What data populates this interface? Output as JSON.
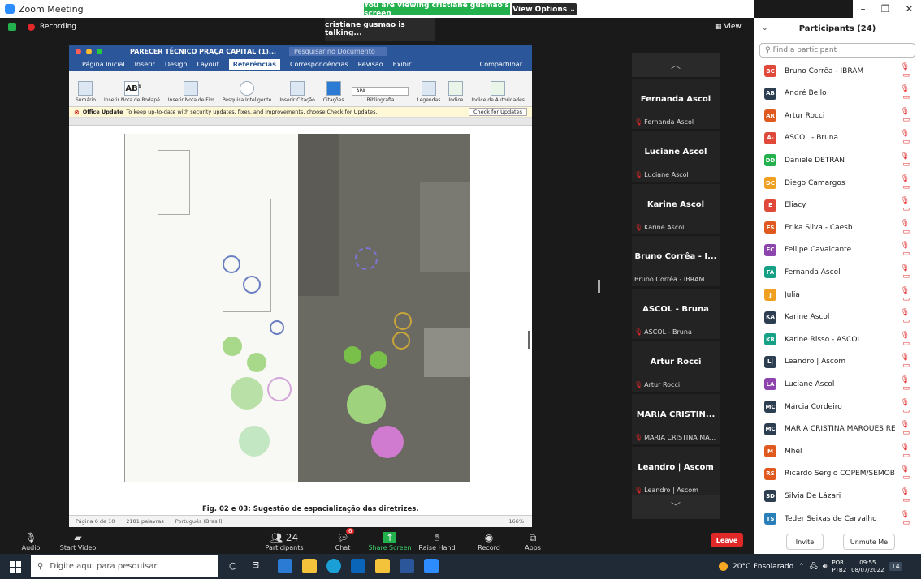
{
  "titlebar": {
    "app_title": "Zoom Meeting",
    "minimize": "–",
    "maximize": "❐",
    "close": "✕"
  },
  "banner": {
    "text": "You are viewing cristiane gusmao's screen",
    "view_options": "View Options ⌄"
  },
  "meeting": {
    "recording": "Recording",
    "talking": "cristiane gusmao is talking...",
    "view": "View"
  },
  "word": {
    "title": "PARECER TÉCNICO PRAÇA CAPITAL (1)...",
    "search_placeholder": "Pesquisar no Documento",
    "tabs": [
      "Página Inicial",
      "Inserir",
      "Design",
      "Layout",
      "Referências",
      "Correspondências",
      "Revisão",
      "Exibir"
    ],
    "active_tab": "Referências",
    "share": "Compartilhar",
    "ribbon": [
      "Sumário",
      "Inserir Nota de Rodapé",
      "Inserir Nota de Fim",
      "Pesquisa Inteligente",
      "Inserir Citação",
      "Citações",
      "Bibliografia",
      "Legendas",
      "Índice",
      "Índice de Autoridades"
    ],
    "citation_style": "APA",
    "update_label": "Office Update",
    "update_text": "To keep up-to-date with security updates, fixes, and improvements, choose Check for Updates.",
    "update_button": "Check for Updates",
    "caption": "Fig. 02 e 03: Sugestão de espacialização das diretrizes.",
    "status_page": "Página 6 de 10",
    "status_words": "2181 palavras",
    "status_lang": "Português (Brasil)",
    "zoom": "166%"
  },
  "strip": {
    "up": "︿",
    "down": "﹀",
    "tiles": [
      {
        "name": "Fernanda Ascol",
        "sub": "Fernanda Ascol",
        "muted": true
      },
      {
        "name": "Luciane Ascol",
        "sub": "Luciane Ascol",
        "muted": true
      },
      {
        "name": "Karine Ascol",
        "sub": "Karine Ascol",
        "muted": true
      },
      {
        "name": "Bruno Corrêa - I...",
        "sub": "Bruno Corrêa - IBRAM",
        "muted": false
      },
      {
        "name": "ASCOL - Bruna",
        "sub": "ASCOL - Bruna",
        "muted": true
      },
      {
        "name": "Artur Rocci",
        "sub": "Artur Rocci",
        "muted": true
      },
      {
        "name": "MARIA CRISTIN...",
        "sub": "MARIA CRISTINA MA...",
        "muted": true
      },
      {
        "name": "Leandro | Ascom",
        "sub": "Leandro | Ascom",
        "muted": true
      }
    ]
  },
  "toolbar": {
    "audio": "Audio",
    "start_video": "Start Video",
    "participants": "Participants",
    "participants_count": "24",
    "chat": "Chat",
    "chat_badge": "6",
    "share": "Share Screen",
    "raise": "Raise Hand",
    "record": "Record",
    "apps": "Apps",
    "leave": "Leave"
  },
  "panel": {
    "title": "Participants (24)",
    "find_placeholder": "Find a participant",
    "invite": "Invite",
    "unmute_me": "Unmute Me",
    "participants": [
      {
        "initials": "BC",
        "name": "Bruno Corrêa - IBRAM",
        "color": "#e0483a"
      },
      {
        "initials": "AB",
        "name": "André Bello",
        "color": "#2c3e50"
      },
      {
        "initials": "AR",
        "name": "Artur Rocci",
        "color": "#e05a1f"
      },
      {
        "initials": "A-",
        "name": "ASCOL - Bruna",
        "color": "#e0483a"
      },
      {
        "initials": "DD",
        "name": "Daniele DETRAN",
        "color": "#22b14c"
      },
      {
        "initials": "DC",
        "name": "Diego Camargos",
        "color": "#f0a020"
      },
      {
        "initials": "E",
        "name": "Eliacy",
        "color": "#e0483a"
      },
      {
        "initials": "ES",
        "name": "Erika Silva - Caesb",
        "color": "#e05a1f"
      },
      {
        "initials": "FC",
        "name": "Fellipe Cavalcante",
        "color": "#8e44ad"
      },
      {
        "initials": "FA",
        "name": "Fernanda Ascol",
        "color": "#16a085"
      },
      {
        "initials": "J",
        "name": "Julia",
        "color": "#f0a020"
      },
      {
        "initials": "KA",
        "name": "Karine Ascol",
        "color": "#2c3e50"
      },
      {
        "initials": "KR",
        "name": "Karine Risso - ASCOL",
        "color": "#16a085"
      },
      {
        "initials": "L|",
        "name": "Leandro | Ascom",
        "color": "#2c3e50"
      },
      {
        "initials": "LA",
        "name": "Luciane Ascol",
        "color": "#8e44ad"
      },
      {
        "initials": "MC",
        "name": "Márcia Cordeiro",
        "color": "#2c3e50"
      },
      {
        "initials": "MC",
        "name": "MARIA CRISTINA MARQUES RE...",
        "color": "#2c3e50"
      },
      {
        "initials": "M",
        "name": "Mhel",
        "color": "#e05a1f"
      },
      {
        "initials": "RS",
        "name": "Ricardo Sergio COPEM/SEMOB",
        "color": "#e05a1f"
      },
      {
        "initials": "SD",
        "name": "Silvia De Lázari",
        "color": "#2c3e50"
      },
      {
        "initials": "TS",
        "name": "Teder Seixas de Carvalho",
        "color": "#2980b9"
      }
    ]
  },
  "taskbar": {
    "search_placeholder": "Digite aqui para pesquisar",
    "weather": "20°C Ensolarado",
    "lang": "POR",
    "lang2": "PTB2",
    "time": "09:55",
    "date": "08/07/2022",
    "notif_count": "14"
  }
}
